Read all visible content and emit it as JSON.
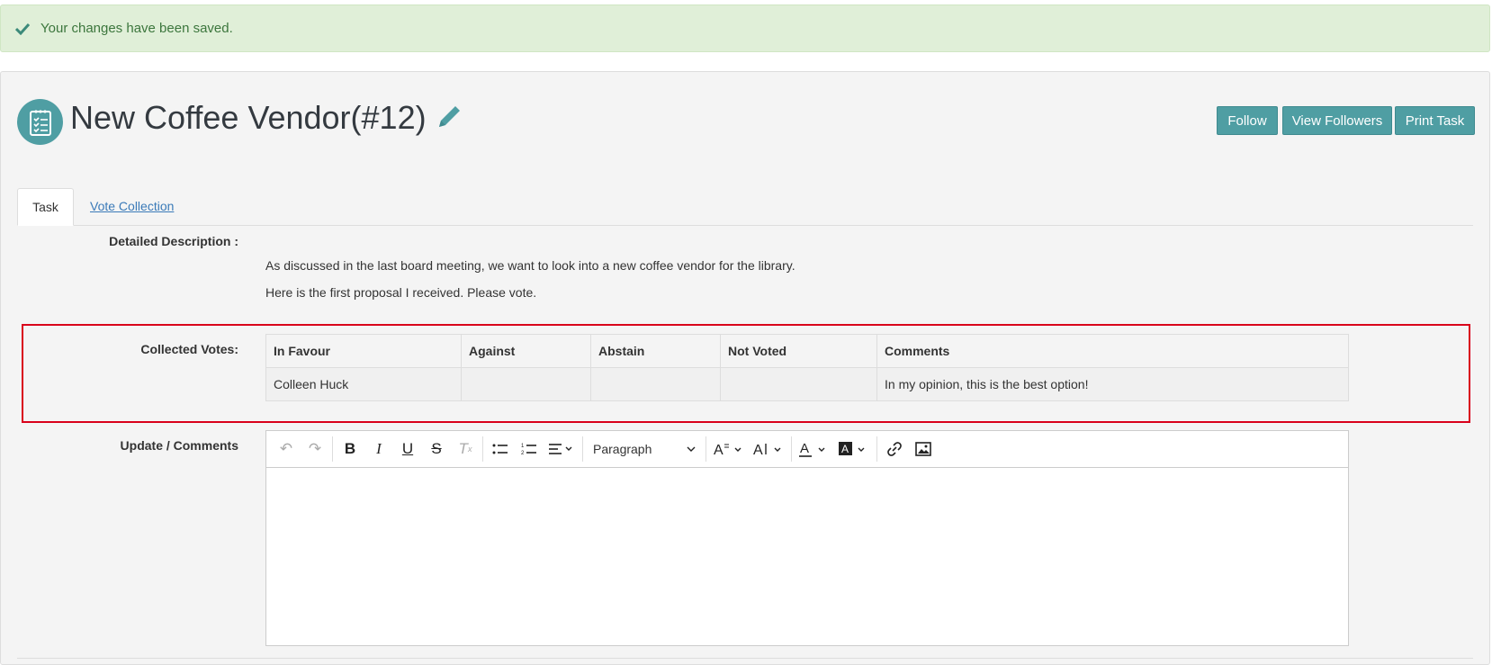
{
  "alert": {
    "message": "Your changes have been saved.",
    "icon": "check-icon"
  },
  "header": {
    "title": "New Coffee Vendor(#12)",
    "icon": "task-list-icon",
    "edit_icon": "pencil-icon",
    "buttons": {
      "follow": "Follow",
      "view_followers": "View Followers",
      "print_task": "Print Task"
    }
  },
  "tabs": {
    "task": "Task",
    "vote_collection": "Vote Collection"
  },
  "description": {
    "label": "Detailed Description :",
    "lines": [
      "As discussed in the last board meeting, we want to look into a new coffee vendor for the library.",
      "Here is the first proposal I received. Please vote."
    ]
  },
  "votes": {
    "label": "Collected Votes:",
    "headers": [
      "In Favour",
      "Against",
      "Abstain",
      "Not Voted",
      "Comments"
    ],
    "rows": [
      [
        "Colleen Huck",
        "",
        "",
        "",
        "In my opinion, this is the best option!"
      ]
    ]
  },
  "comments": {
    "label": "Update / Comments",
    "format_select": "Paragraph"
  },
  "colors": {
    "accent": "#4f9ea3",
    "success_bg": "#e0efd8",
    "success_text": "#3c763d",
    "highlight": "#d9001b"
  }
}
